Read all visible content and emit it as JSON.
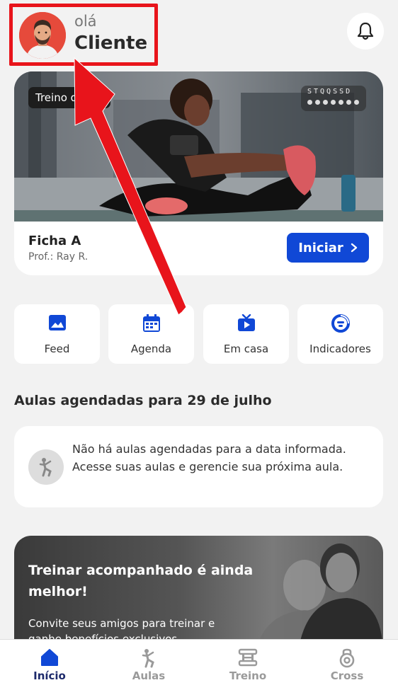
{
  "header": {
    "greeting": "olá",
    "user_name": "Cliente"
  },
  "workout_card": {
    "photo_tag": "Treino do dia",
    "week_days": "STQQSSD",
    "title": "Ficha A",
    "professor": "Prof.: Ray R.",
    "start_label": "Iniciar"
  },
  "quick_actions": [
    {
      "label": "Feed",
      "icon": "image-icon"
    },
    {
      "label": "Agenda",
      "icon": "calendar-icon"
    },
    {
      "label": "Em casa",
      "icon": "tv-play-icon"
    },
    {
      "label": "Indicadores",
      "icon": "gauge-icon"
    }
  ],
  "classes": {
    "section_title": "Aulas agendadas para 29 de julho",
    "empty_message": "Não há aulas agendadas para a data informada. Acesse suas aulas e gerencie sua próxima aula."
  },
  "promo": {
    "title": "Treinar acompanhado é ainda melhor!",
    "subtitle": "Convite seus amigos para treinar e ganhe benefícios exclusivos"
  },
  "tabbar": [
    {
      "label": "Início",
      "icon": "home-icon",
      "active": true
    },
    {
      "label": "Aulas",
      "icon": "dancer-icon",
      "active": false
    },
    {
      "label": "Treino",
      "icon": "dumbbell-icon",
      "active": false
    },
    {
      "label": "Cross",
      "icon": "kettlebell-icon",
      "active": false
    }
  ],
  "colors": {
    "accent": "#1048d6",
    "highlight": "#e8141b",
    "background": "#f2f2f2"
  }
}
